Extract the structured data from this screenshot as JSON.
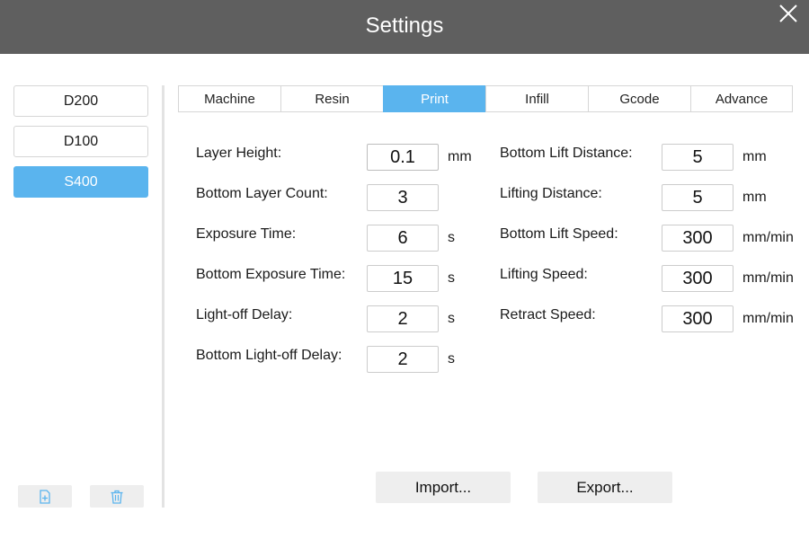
{
  "window": {
    "title": "Settings"
  },
  "profiles": [
    {
      "label": "D200",
      "active": false
    },
    {
      "label": "D100",
      "active": false
    },
    {
      "label": "S400",
      "active": true
    }
  ],
  "sidebar_buttons": {
    "new_icon": "new-file-icon",
    "delete_icon": "trash-icon"
  },
  "tabs": [
    {
      "label": "Machine",
      "active": false
    },
    {
      "label": "Resin",
      "active": false
    },
    {
      "label": "Print",
      "active": true
    },
    {
      "label": "Infill",
      "active": false
    },
    {
      "label": "Gcode",
      "active": false
    },
    {
      "label": "Advance",
      "active": false
    }
  ],
  "left_fields": [
    {
      "label": "Layer Height:",
      "value": "0.1",
      "unit": "mm"
    },
    {
      "label": "Bottom Layer Count:",
      "value": "3",
      "unit": ""
    },
    {
      "label": "Exposure Time:",
      "value": "6",
      "unit": "s"
    },
    {
      "label": "Bottom Exposure Time:",
      "value": "15",
      "unit": "s"
    },
    {
      "label": "Light-off Delay:",
      "value": "2",
      "unit": "s"
    },
    {
      "label": "Bottom Light-off Delay:",
      "value": "2",
      "unit": "s"
    }
  ],
  "right_fields": [
    {
      "label": "Bottom Lift Distance:",
      "value": "5",
      "unit": "mm"
    },
    {
      "label": "Lifting Distance:",
      "value": "5",
      "unit": "mm"
    },
    {
      "label": "Bottom Lift Speed:",
      "value": "300",
      "unit": "mm/min"
    },
    {
      "label": "Lifting Speed:",
      "value": "300",
      "unit": "mm/min"
    },
    {
      "label": "Retract Speed:",
      "value": "300",
      "unit": "mm/min"
    }
  ],
  "actions": {
    "import_label": "Import...",
    "export_label": "Export..."
  },
  "colors": {
    "titlebar": "#5f5f5f",
    "accent": "#5ab4ee",
    "button_bg": "#eeeeee"
  }
}
